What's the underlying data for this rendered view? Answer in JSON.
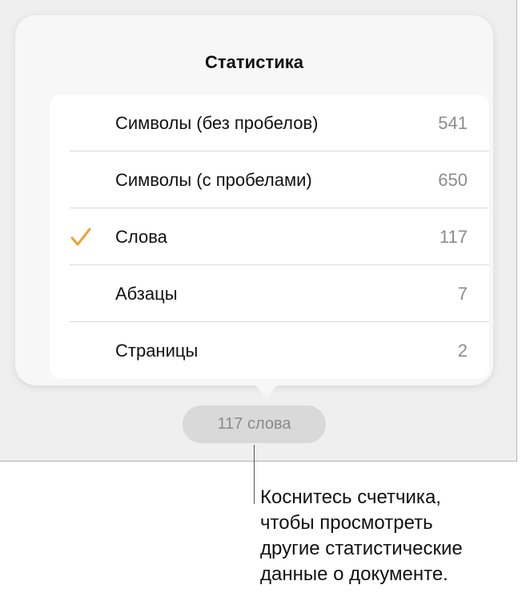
{
  "popover": {
    "title": "Статистика",
    "rows": [
      {
        "label": "Символы (без пробелов)",
        "value": "541",
        "selected": false
      },
      {
        "label": "Символы (с пробелами)",
        "value": "650",
        "selected": false
      },
      {
        "label": "Слова",
        "value": "117",
        "selected": true
      },
      {
        "label": "Абзацы",
        "value": "7",
        "selected": false
      },
      {
        "label": "Страницы",
        "value": "2",
        "selected": false
      }
    ]
  },
  "counter": {
    "label": "117 слова"
  },
  "callout": {
    "text": "Коснитесь счетчика,\nчтобы просмотреть\nдругие статистические\nданные о документе."
  },
  "colors": {
    "accent_check": "#f0a030",
    "screen_bg": "#efefef",
    "popover_bg": "#f7f7f7",
    "counter_bg": "#d9d9d9"
  },
  "icons": {
    "selected_row_icon": "checkmark-icon"
  }
}
